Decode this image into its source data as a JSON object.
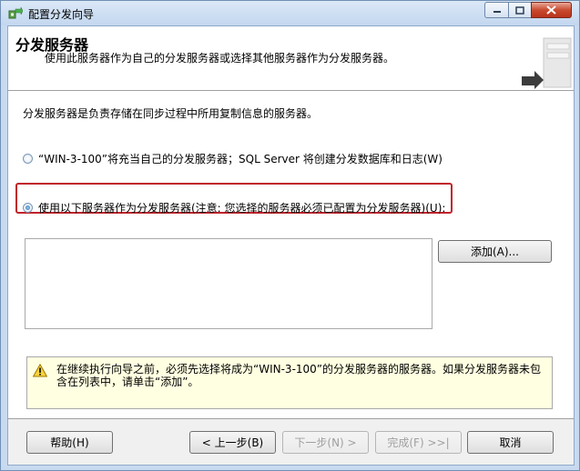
{
  "window": {
    "title": "配置分发向导",
    "icon": "wizard-icon"
  },
  "header": {
    "title": "分发服务器",
    "subtitle": "使用此服务器作为自己的分发服务器或选择其他服务器作为分发服务器。"
  },
  "body": {
    "intro": "分发服务器是负责存储在同步过程中所用复制信息的服务器。",
    "options": [
      {
        "label": "“WIN-3-100”将充当自己的分发服务器；SQL Server 将创建分发数据库和日志(W)",
        "selected": false
      },
      {
        "label": "使用以下服务器作为分发服务器(注意: 您选择的服务器必须已配置为分发服务器)(U):",
        "selected": true
      }
    ],
    "add_button": "添加(A)...",
    "warning": "在继续执行向导之前，必须先选择将成为“WIN-3-100”的分发服务器的服务器。如果分发服务器未包含在列表中，请单击“添加”。"
  },
  "footer": {
    "help": "帮助(H)",
    "back": "< 上一步(B)",
    "next": "下一步(N) >",
    "finish": "完成(F) >>|",
    "cancel": "取消"
  },
  "colors": {
    "highlight": "#c0232b",
    "warning_bg": "#ffffe1"
  }
}
